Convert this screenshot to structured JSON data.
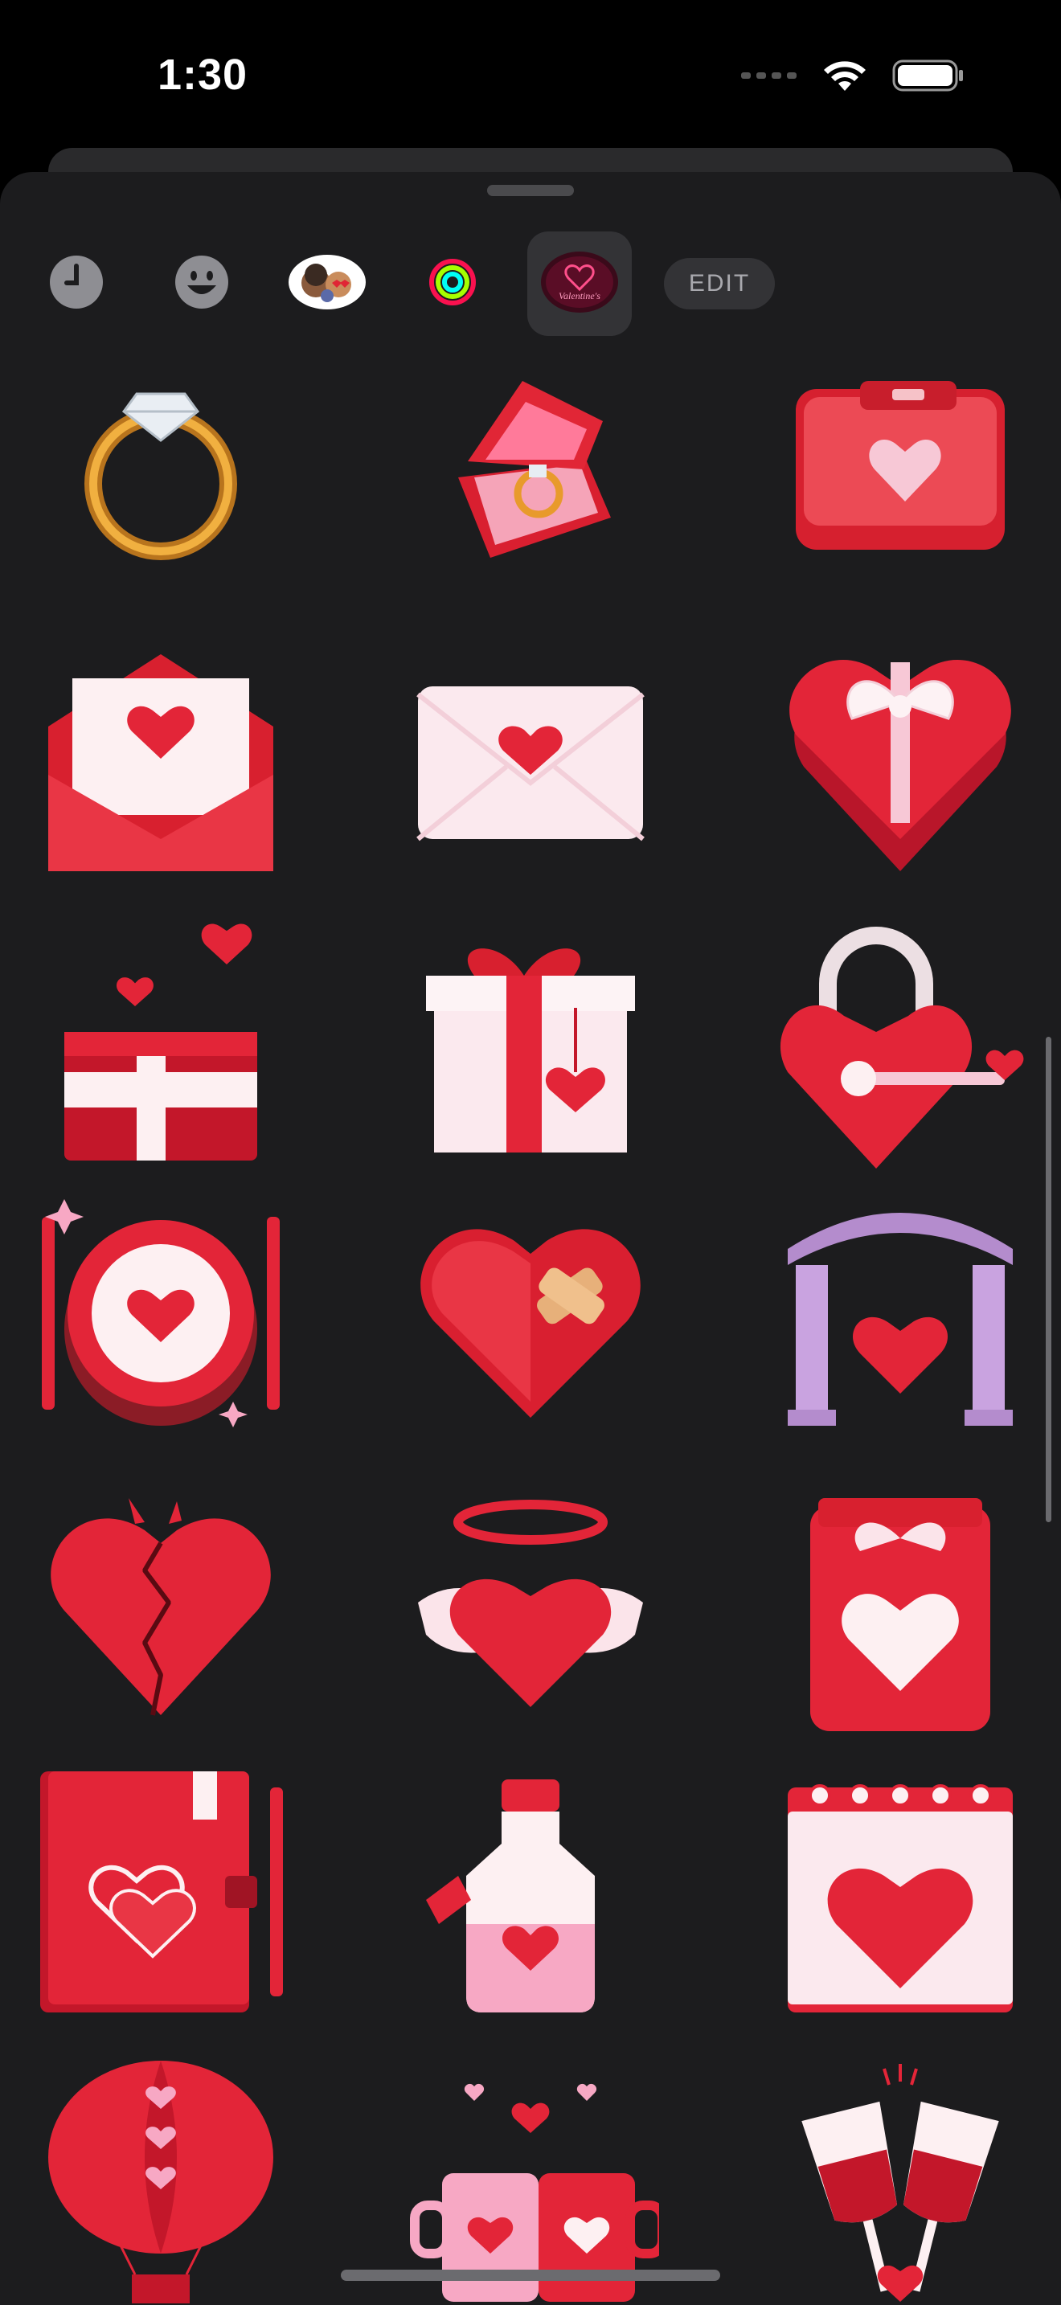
{
  "status_bar": {
    "time": "1:30"
  },
  "categories": [
    {
      "name": "recents",
      "icon": "clock-icon"
    },
    {
      "name": "emoji",
      "icon": "smiley-icon"
    },
    {
      "name": "memoji",
      "icon": "memoji-stickers-icon"
    },
    {
      "name": "activity",
      "icon": "activity-rings-icon"
    },
    {
      "name": "valentines-pack",
      "icon": "valentines-pack-icon",
      "selected": true
    }
  ],
  "edit_label": "EDIT",
  "stickers": [
    "diamond-ring",
    "ring-box",
    "heart-wallet",
    "love-letter-open",
    "love-envelope",
    "heart-gift-box",
    "gift-with-hearts",
    "gift-box-heart-tag",
    "heart-padlock-key",
    "heart-dinner-plate",
    "bandaged-heart",
    "heart-arch",
    "broken-heart",
    "angel-heart",
    "heart-jar",
    "heart-diary",
    "love-potion",
    "heart-calendar",
    "heart-balloon",
    "heart-mugs",
    "champagne-toast"
  ],
  "colors": {
    "accent_red": "#e8283a",
    "sheet_bg": "#1c1c1e",
    "pink": "#f7c8d6"
  }
}
